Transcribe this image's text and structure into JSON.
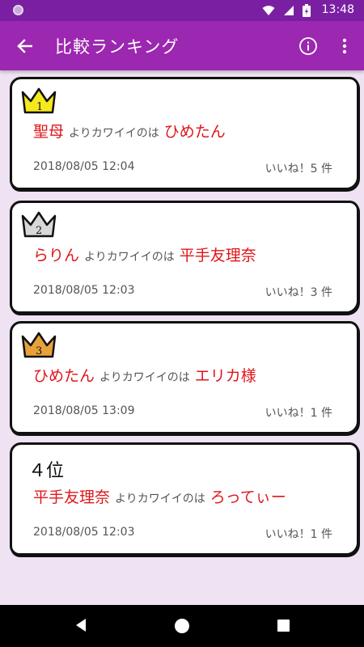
{
  "status": {
    "time": "13:48"
  },
  "appbar": {
    "title": "比較ランキング"
  },
  "colors": {
    "appbar": "#9c27b0",
    "statusbar": "#7b1fa2",
    "background": "#efe2f3",
    "name_red": "#e0151a",
    "gold": "#f5e81c",
    "silver": "#d8d8d8",
    "bronze": "#e8a23a"
  },
  "cards": [
    {
      "rank_icon": "gold-crown-icon",
      "rank_number": "1",
      "winner": "聖母",
      "middle": "よりカワイイのは",
      "loser": "ひめたん",
      "date": "2018/08/05 12:04",
      "likes": "いいね！5 件"
    },
    {
      "rank_icon": "silver-crown-icon",
      "rank_number": "2",
      "winner": "らりん",
      "middle": "よりカワイイのは",
      "loser": "平手友理奈",
      "date": "2018/08/05 12:03",
      "likes": "いいね！3 件"
    },
    {
      "rank_icon": "bronze-crown-icon",
      "rank_number": "3",
      "winner": "ひめたん",
      "middle": "よりカワイイのは",
      "loser": "エリカ様",
      "date": "2018/08/05 13:09",
      "likes": "いいね！1 件"
    },
    {
      "rank_text": "４位",
      "winner": "平手友理奈",
      "middle": "よりカワイイのは",
      "loser": "ろってぃー",
      "date": "2018/08/05 12:03",
      "likes": "いいね！1 件"
    }
  ]
}
